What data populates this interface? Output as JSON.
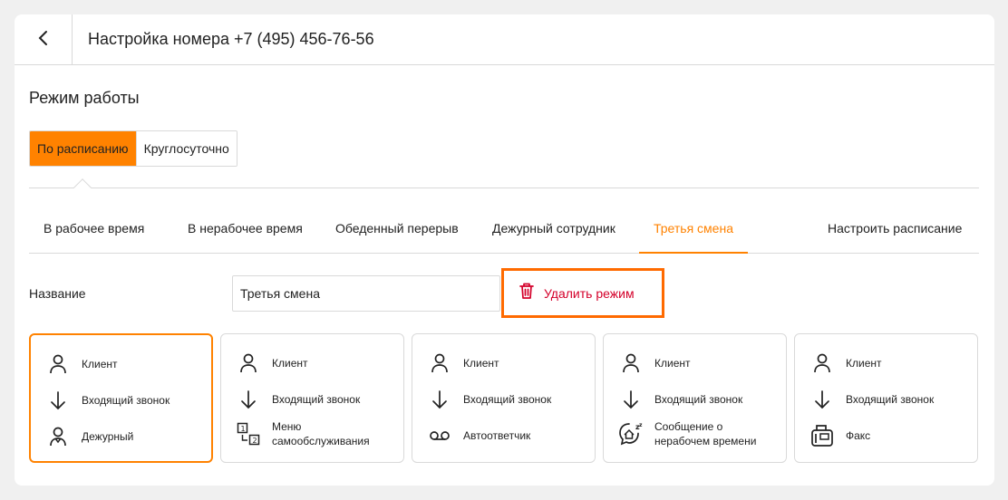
{
  "header": {
    "title": "Настройка номера +7 (495) 456-76-56"
  },
  "mode_section": {
    "title": "Режим работы",
    "options": [
      {
        "label": "По расписанию",
        "selected": true
      },
      {
        "label": "Круглосуточно",
        "selected": false
      }
    ]
  },
  "tabs": [
    {
      "label": "В рабочее время"
    },
    {
      "label": "В нерабочее время"
    },
    {
      "label": "Обеденный перерыв"
    },
    {
      "label": "Дежурный сотрудник"
    },
    {
      "label": "Третья смена",
      "active": true
    },
    {
      "label": "Настроить расписание"
    }
  ],
  "name_field": {
    "label": "Название",
    "value": "Третья смена"
  },
  "delete_button": {
    "label": "Удалить режим"
  },
  "colors": {
    "accent": "#ff8200",
    "danger": "#d4002a",
    "highlight": "#ff6a00"
  },
  "cards": [
    {
      "client": "Клиент",
      "call": "Входящий звонок",
      "target": "Дежурный",
      "target_icon": "duty-person-icon",
      "selected": true
    },
    {
      "client": "Клиент",
      "call": "Входящий звонок",
      "target": "Меню самообслуживания",
      "target_icon": "ivr-menu-icon",
      "selected": false
    },
    {
      "client": "Клиент",
      "call": "Входящий звонок",
      "target": "Автоответчик",
      "target_icon": "voicemail-icon",
      "selected": false
    },
    {
      "client": "Клиент",
      "call": "Входящий звонок",
      "target": "Сообщение о нерабочем времени",
      "target_icon": "offhours-message-icon",
      "selected": false
    },
    {
      "client": "Клиент",
      "call": "Входящий звонок",
      "target": "Факс",
      "target_icon": "fax-icon",
      "selected": false
    }
  ]
}
